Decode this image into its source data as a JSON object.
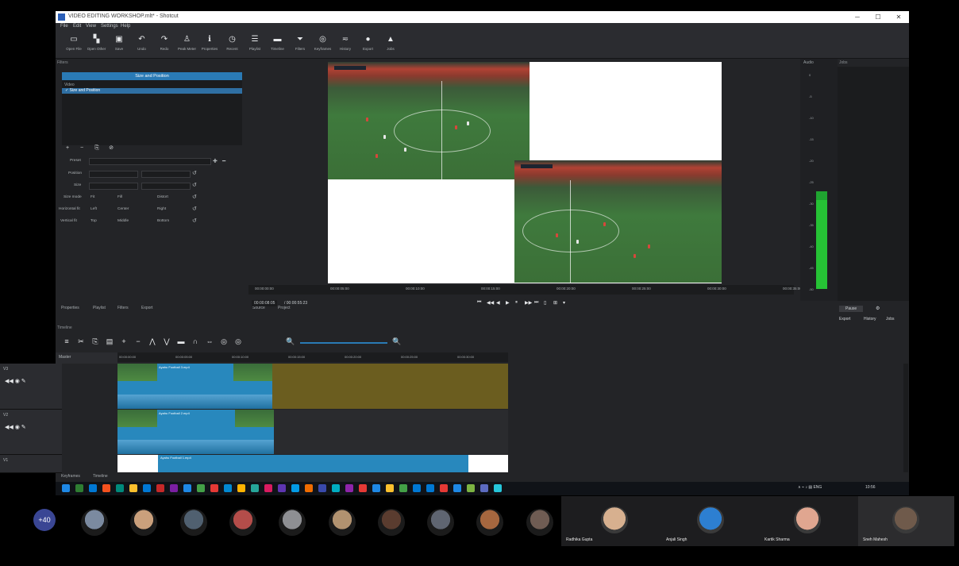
{
  "window": {
    "title": "VIDEO EDITING WORKSHOP.mlt* - Shotcut",
    "controls": [
      "─",
      "☐",
      "✕"
    ]
  },
  "menu": [
    "File",
    "Edit",
    "View",
    "Settings",
    "Help"
  ],
  "toolbar": [
    {
      "icon": "open-file-icon",
      "glyph": "▭",
      "label": "Open File"
    },
    {
      "icon": "open-other-icon",
      "glyph": "▚",
      "label": "Open Other"
    },
    {
      "icon": "save-icon",
      "glyph": "▣",
      "label": "Save"
    },
    {
      "icon": "undo-icon",
      "glyph": "↶",
      "label": "Undo"
    },
    {
      "icon": "redo-icon",
      "glyph": "↷",
      "label": "Redo"
    },
    {
      "icon": "peak-meter-icon",
      "glyph": "♙",
      "label": "Peak Meter"
    },
    {
      "icon": "properties-icon",
      "glyph": "ℹ",
      "label": "Properties"
    },
    {
      "icon": "recent-icon",
      "glyph": "◷",
      "label": "Recent"
    },
    {
      "icon": "playlist-icon",
      "glyph": "☰",
      "label": "Playlist"
    },
    {
      "icon": "timeline-icon",
      "glyph": "▬",
      "label": "Timeline"
    },
    {
      "icon": "filters-icon",
      "glyph": "⏷",
      "label": "Filters"
    },
    {
      "icon": "keyframes-icon",
      "glyph": "◎",
      "label": "Keyframes"
    },
    {
      "icon": "history-icon",
      "glyph": "≂",
      "label": "History"
    },
    {
      "icon": "export-icon",
      "glyph": "●",
      "label": "Export"
    },
    {
      "icon": "jobs-icon",
      "glyph": "▲",
      "label": "Jobs"
    }
  ],
  "filters_panel": {
    "title": "Filters",
    "header": "Size and Position",
    "list_heading": "Video",
    "selected_filter": "✓ Size and Position",
    "preset_label": "Preset",
    "position_label": "Position",
    "size_label": "Size",
    "size_mode_label": "Size mode",
    "halign_label": "Horizontal fit",
    "valign_label": "Vertical fit",
    "fit": "Fit",
    "fill": "Fill",
    "distort": "Distort",
    "left": "Left",
    "center": "Center",
    "right": "Right",
    "top": "Top",
    "middle": "Middle",
    "bottom": "Bottom"
  },
  "panel_tabs": [
    "Properties",
    "Playlist",
    "Filters",
    "Export"
  ],
  "viewer": {
    "ruler_ticks": [
      "00:00:00:00",
      "00:00:05:00",
      "00:00:10:00",
      "00:00:15:00",
      "00:00:20:00",
      "00:00:25:00",
      "00:00:30:00",
      "00:00:35:00"
    ],
    "current_timecode": "00:00:08:05",
    "total_timecode": "/ 00:00:55:23",
    "source_tab": "Source",
    "project_tab": "Project"
  },
  "transport": [
    "⏮",
    "◀◀",
    "◀",
    "▶",
    "⏸",
    "▶▶",
    "⏭",
    "▯",
    "⊞",
    "▾"
  ],
  "meters": {
    "title": "Audio",
    "ticks": [
      "0",
      "-5",
      "-10",
      "-15",
      "-20",
      "-25",
      "-30",
      "-35",
      "-40",
      "-45",
      "-50"
    ]
  },
  "jobs": {
    "title": "Jobs",
    "pause_button": "Pause",
    "tabs": [
      "Export",
      "History",
      "Jobs"
    ]
  },
  "timeline": {
    "title": "Timeline",
    "tracks_label": "Master",
    "ruler": [
      "00:00:00:00",
      "00:00:05:00",
      "00:00:10:00",
      "00:00:15:00",
      "00:00:20:00",
      "00:00:25:00",
      "00:00:30:00"
    ],
    "tracks": [
      "V3",
      "V2",
      "V1"
    ],
    "track_icons": "◀◀ ◉ ✎",
    "clip_labels": [
      "Ayahu Football 3.mp4",
      "Ayahu Football 2.mp4",
      "Ayahu Football 1.mp4"
    ],
    "tools": [
      "≡",
      "✂",
      "⎘",
      "▤",
      "+",
      "−",
      "⋀",
      "⋁",
      "▬",
      "∩",
      "⇔",
      "◎",
      "◎",
      "🔍",
      "🔍"
    ]
  },
  "bottom_tabs": [
    "Keyframes",
    "Timeline"
  ],
  "taskbar": {
    "time": "10:56",
    "tray": "∧ ⌁ ♪ ▤ ENG",
    "icons": [
      "#1e88e5",
      "#2e7d32",
      "#0078d4",
      "#f4511e",
      "#00897b",
      "#fbc02d",
      "#0078d4",
      "#c62828",
      "#7b1fa2",
      "#1e88e5",
      "#43a047",
      "#e53935",
      "#0288d1",
      "#ffb300",
      "#26a69a",
      "#d81b60",
      "#5e35b1",
      "#039be5",
      "#ef6c00",
      "#3949ab",
      "#00acc1",
      "#8e24aa",
      "#e53935",
      "#1e88e5",
      "#fbc02d",
      "#43a047",
      "#0078d4",
      "#0078d4",
      "#e53935",
      "#1e88e5",
      "#7cb342",
      "#5c6bc0",
      "#26c6da"
    ]
  },
  "meeting": {
    "more_count": "+40",
    "attendees": [
      {
        "name": "Radhika Gupta",
        "avatar": "#d7b08f"
      },
      {
        "name": "Anjali Singh",
        "avatar": "#2d7fd1"
      },
      {
        "name": "Kartik Sharma",
        "avatar": "#e0a690"
      },
      {
        "name": "Sneh Mahesh",
        "avatar": "#6f5a4b"
      }
    ],
    "thumbs": [
      "#7b8aa0",
      "#caa07c",
      "#506070",
      "#b44d4a",
      "#8e8f93",
      "#b19270",
      "#5a3c2f",
      "#5f6571",
      "#a6673f",
      "#6f5c53"
    ]
  },
  "colors": {
    "accent": "#2a7ab5",
    "track_bg_v3": "#6b5d1f",
    "meter_green": "#26c235"
  }
}
